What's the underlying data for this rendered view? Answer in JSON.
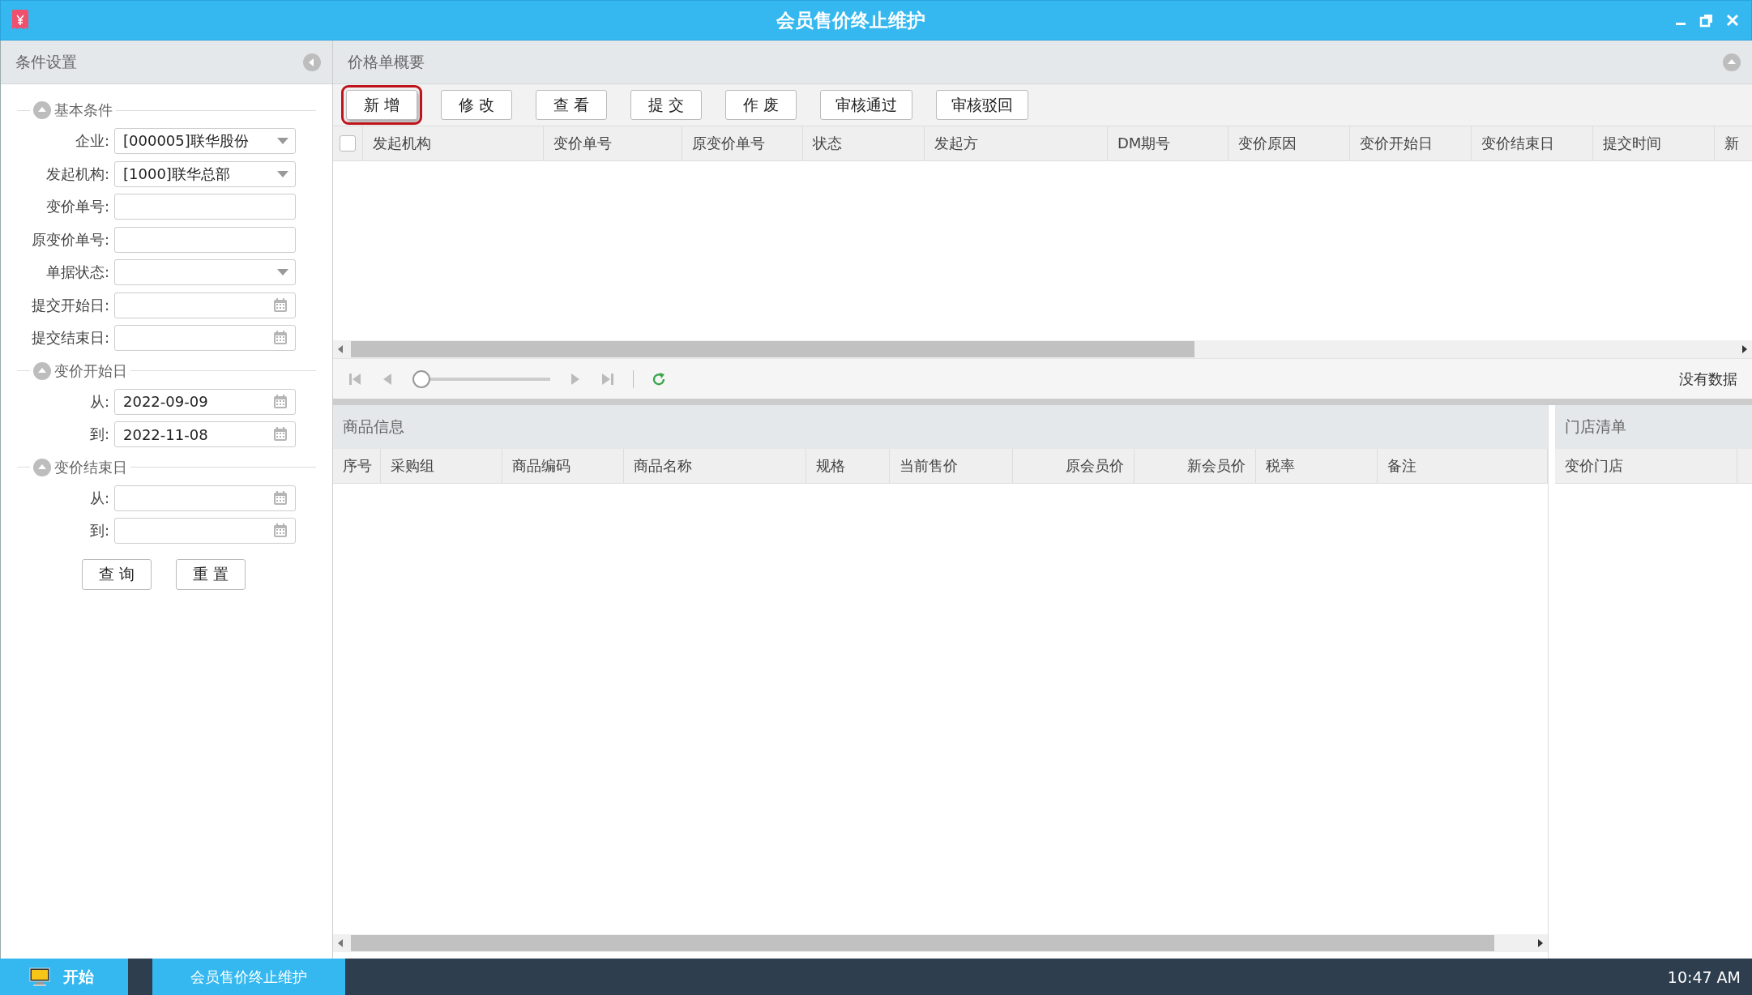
{
  "window": {
    "title": "会员售价终止维护"
  },
  "sidebar": {
    "title": "条件设置",
    "sections": [
      {
        "title": "基本条件",
        "expanded": true,
        "fields": [
          {
            "label": "企业:",
            "kind": "dropdown",
            "value": "[000005]联华股份"
          },
          {
            "label": "发起机构:",
            "kind": "dropdown",
            "value": "[1000]联华总部"
          },
          {
            "label": "变价单号:",
            "kind": "text"
          },
          {
            "label": "原变价单号:",
            "kind": "text"
          },
          {
            "label": "单据状态:",
            "kind": "dropdown"
          },
          {
            "label": "提交开始日:",
            "kind": "date"
          },
          {
            "label": "提交结束日:",
            "kind": "date"
          }
        ]
      },
      {
        "title": "变价开始日",
        "expanded": true,
        "fields": [
          {
            "label": "从:",
            "kind": "date",
            "value": "2022-09-09"
          },
          {
            "label": "到:",
            "kind": "date",
            "value": "2022-11-08"
          }
        ]
      },
      {
        "title": "变价结束日",
        "expanded": true,
        "fields": [
          {
            "label": "从:",
            "kind": "date"
          },
          {
            "label": "到:",
            "kind": "date"
          }
        ]
      }
    ],
    "buttons": [
      "查 询",
      "重 置"
    ]
  },
  "price_list": {
    "title": "价格单概要",
    "toolbar": [
      {
        "label": "新 增",
        "highlighted": true
      },
      {
        "label": "修 改",
        "highlighted": false
      },
      {
        "label": "查 看",
        "highlighted": false
      },
      {
        "label": "提 交",
        "highlighted": false
      },
      {
        "label": "作 废",
        "highlighted": false
      },
      {
        "label": "审核通过",
        "highlighted": false
      },
      {
        "label": "审核驳回",
        "highlighted": false
      }
    ],
    "table": {
      "select_all": {
        "checked": false
      },
      "columns": [
        "发起机构",
        "变价单号",
        "原变价单号",
        "状态",
        "发起方",
        "DM期号",
        "变价原因",
        "变价开始日",
        "变价结束日",
        "提交时间",
        "新"
      ]
    },
    "pager": {
      "level": 0,
      "status": "没有数据"
    }
  },
  "product_info": {
    "title": "商品信息",
    "columns": [
      {
        "label": "序号",
        "kind": "text"
      },
      {
        "label": "采购组",
        "kind": "text"
      },
      {
        "label": "商品编码",
        "kind": "text"
      },
      {
        "label": "商品名称",
        "kind": "text"
      },
      {
        "label": "规格",
        "kind": "text"
      },
      {
        "label": "当前售价",
        "kind": "text"
      },
      {
        "label": "原会员价",
        "kind": "number"
      },
      {
        "label": "新会员价",
        "kind": "number"
      },
      {
        "label": "税率",
        "kind": "text"
      },
      {
        "label": "备注",
        "kind": "text"
      }
    ]
  },
  "store_list": {
    "title": "门店清单",
    "columns": [
      "变价门店"
    ]
  },
  "taskbar": {
    "start": "开始",
    "tasks": [
      {
        "label": "会员售价终止维护",
        "selected": true
      }
    ],
    "clock": "10:47 AM"
  }
}
